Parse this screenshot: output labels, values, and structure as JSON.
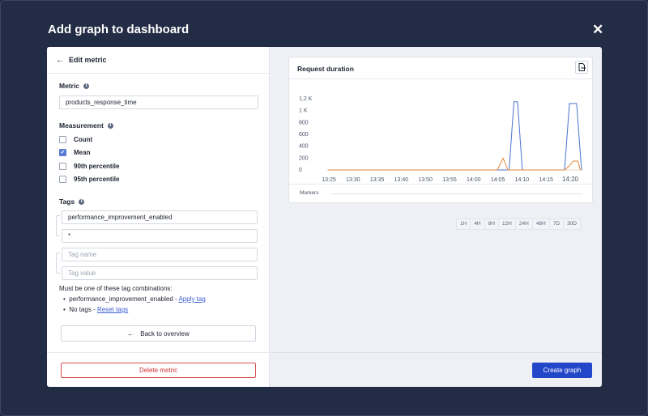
{
  "dialog": {
    "title": "Add graph to dashboard"
  },
  "editor": {
    "back_label": "Edit metric",
    "metric": {
      "label": "Metric",
      "value": "products_response_time"
    },
    "measurement": {
      "label": "Measurement",
      "options": [
        {
          "label": "Count",
          "checked": false
        },
        {
          "label": "Mean",
          "checked": true
        },
        {
          "label": "90th percentile",
          "checked": false
        },
        {
          "label": "95th percentile",
          "checked": false
        }
      ]
    },
    "tags": {
      "label": "Tags",
      "pairs": [
        {
          "name": "performance_improvement_enabled",
          "value": "*"
        }
      ],
      "new_name_placeholder": "Tag name",
      "new_value_placeholder": "Tag value"
    },
    "combinations": {
      "intro": "Must be one of these tag combinations:",
      "items": [
        {
          "text": "performance_improvement_enabled - ",
          "link": "Apply tag"
        },
        {
          "text": "No tags - ",
          "link": "Reset tags"
        }
      ]
    },
    "back_to_overview": "Back to overview",
    "delete_label": "Delete metric"
  },
  "graph_card": {
    "title": "Request duration",
    "markers_label": "Markers"
  },
  "chart_data": {
    "type": "line",
    "title": "Request duration",
    "x_ticks": [
      "13:25",
      "13:30",
      "13:35",
      "13:40",
      "13:50",
      "13:55",
      "14:00",
      "14:05",
      "14:10",
      "14:15",
      "14:20"
    ],
    "y_ticks": [
      "0",
      "200",
      "400",
      "600",
      "800",
      "1 K",
      "1,2 K"
    ],
    "ylim": [
      0,
      1200
    ],
    "series": [
      {
        "color": "#4a73cf",
        "points": [
          [
            0,
            0
          ],
          [
            7,
            0
          ],
          [
            7.25,
            0
          ],
          [
            7.5,
            0
          ],
          [
            7.7,
            1150
          ],
          [
            7.85,
            1150
          ],
          [
            8.05,
            0
          ],
          [
            9.5,
            0
          ],
          [
            9.8,
            0
          ],
          [
            10,
            1120
          ],
          [
            10.3,
            1120
          ],
          [
            10.5,
            0
          ]
        ]
      },
      {
        "color": "#e0873a",
        "points": [
          [
            0,
            0
          ],
          [
            7,
            0
          ],
          [
            7.1,
            70
          ],
          [
            7.25,
            200
          ],
          [
            7.45,
            0
          ],
          [
            9.8,
            0
          ],
          [
            10,
            70
          ],
          [
            10.15,
            150
          ],
          [
            10.35,
            150
          ],
          [
            10.45,
            0
          ]
        ]
      }
    ],
    "grid": false,
    "legend": false
  },
  "time_ranges": [
    "1H",
    "4H",
    "8H",
    "12H",
    "24H",
    "48H",
    "7D",
    "30D"
  ],
  "create_label": "Create graph",
  "colors": {
    "accent": "#2347c9",
    "danger": "#d02f35",
    "backdrop": "#232c45"
  }
}
